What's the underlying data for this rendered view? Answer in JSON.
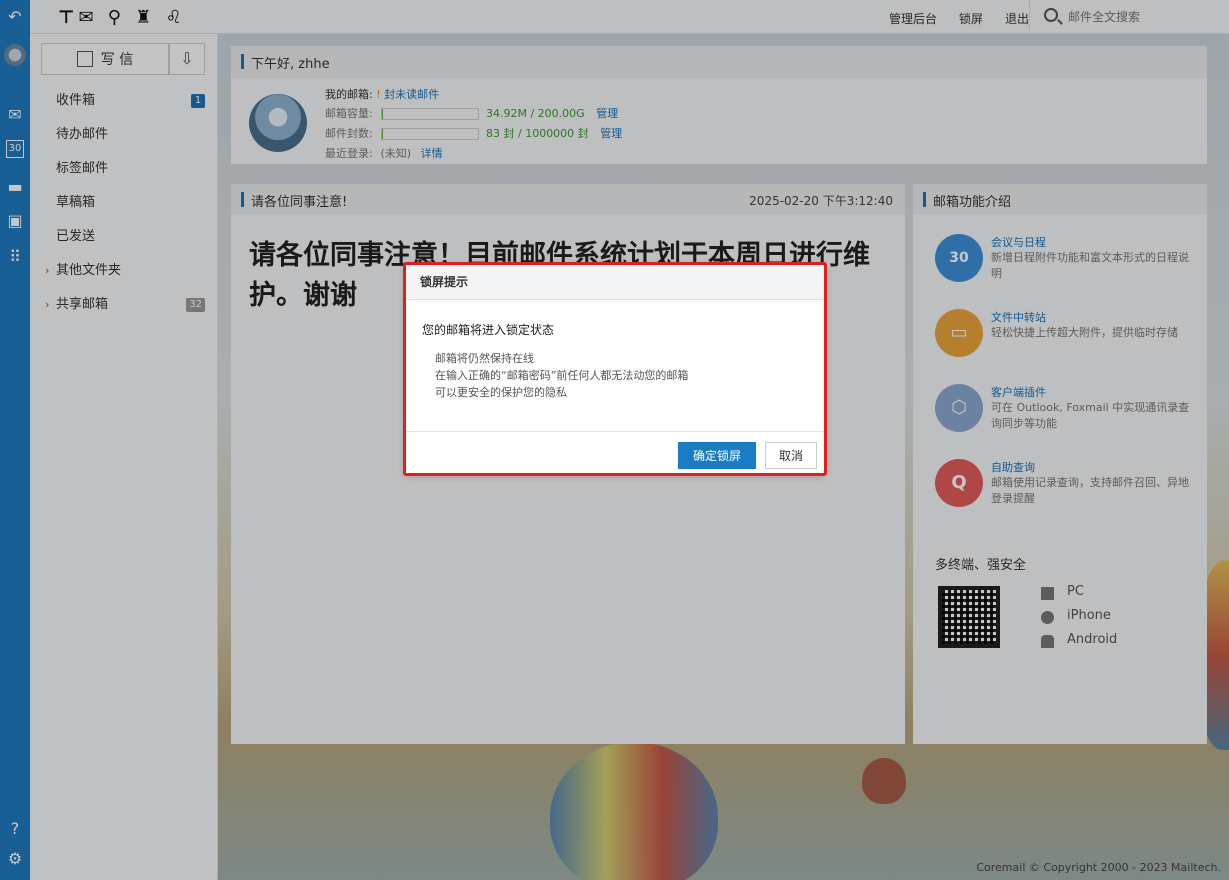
{
  "app": {
    "logo_text": "⊤✉ ⚲ ♜ ♌"
  },
  "topbar": {
    "links": [
      "管理后台",
      "锁屏",
      "退出"
    ],
    "search_placeholder": "邮件全文搜索"
  },
  "iconbar": {
    "items": [
      "back-icon",
      "user-avatar",
      "mail-icon",
      "calendar-icon",
      "folder-icon",
      "contacts-icon",
      "apps-icon",
      "help-icon",
      "settings-icon"
    ],
    "accent": "#1e7abf"
  },
  "sidebar": {
    "compose_label": "写 信",
    "folders": [
      {
        "label": "收件箱",
        "badge": "1",
        "badge_color": "#1a73b8"
      },
      {
        "label": "待办邮件"
      },
      {
        "label": "标签邮件"
      },
      {
        "label": "草稿箱"
      },
      {
        "label": "已发送"
      },
      {
        "label": "其他文件夹",
        "arrow": "›"
      },
      {
        "label": "共享邮箱",
        "arrow": "›",
        "badge": "32",
        "badge_color": "#999"
      }
    ]
  },
  "greeting": {
    "title": "下午好, zhhe",
    "my_mailbox_label": "我的邮箱:",
    "unread_prefix": "!",
    "unread_text": "封未读邮件",
    "capacity_label": "邮箱容量:",
    "capacity_value": "34.92M / 200.00G",
    "capacity_fraction": 0.0002,
    "capacity_link": "管理",
    "count_label": "邮件封数:",
    "count_value": "83 封 / 1000000 封",
    "count_fraction": 0.0001,
    "count_link": "管理",
    "last_login_label": "最近登录:",
    "last_login_value": "(未知)",
    "last_login_link": "详情"
  },
  "notice": {
    "title": "请各位同事注意!",
    "date": "2025-02-20 下午3:12:40",
    "body": "请各位同事注意！目前邮件系统计划于本周日进行维护。谢谢"
  },
  "features": {
    "title": "邮箱功能介绍",
    "items": [
      {
        "title": "会议与日程",
        "desc": "新增日程附件功能和富文本形式的日程说明",
        "icon": "calendar-icon",
        "glyph": "30",
        "color": "#3d8fd6"
      },
      {
        "title": "文件中转站",
        "desc": "轻松快捷上传超大附件，提供临时存储",
        "icon": "folder-icon",
        "glyph": "▭",
        "color": "#e8a33a"
      },
      {
        "title": "客户端插件",
        "desc": "可在 Outlook, Foxmail 中实现通讯录查询同步等功能",
        "icon": "cube-icon",
        "glyph": "⬡",
        "color": "#8aa7cf"
      },
      {
        "title": "自助查询",
        "desc": "邮箱使用记录查询，支持邮件召回、异地登录提醒",
        "icon": "search-icon",
        "glyph": "Q",
        "color": "#e05b5b"
      }
    ],
    "secure_title": "多终端、强安全",
    "platforms": [
      "PC",
      "iPhone",
      "Android"
    ]
  },
  "footer": {
    "text": "Coremail  © Copyright 2000 - 2023 Mailtech."
  },
  "modal": {
    "title": "锁屏提示",
    "message": "您的邮箱将进入锁定状态",
    "lines": [
      "邮箱将仍然保持在线",
      "在输入正确的“邮箱密码”前任何人都无法动您的邮箱",
      "可以更安全的保护您的隐私"
    ],
    "confirm_label": "确定锁屏",
    "cancel_label": "取消",
    "highlight_color": "#e02020"
  }
}
